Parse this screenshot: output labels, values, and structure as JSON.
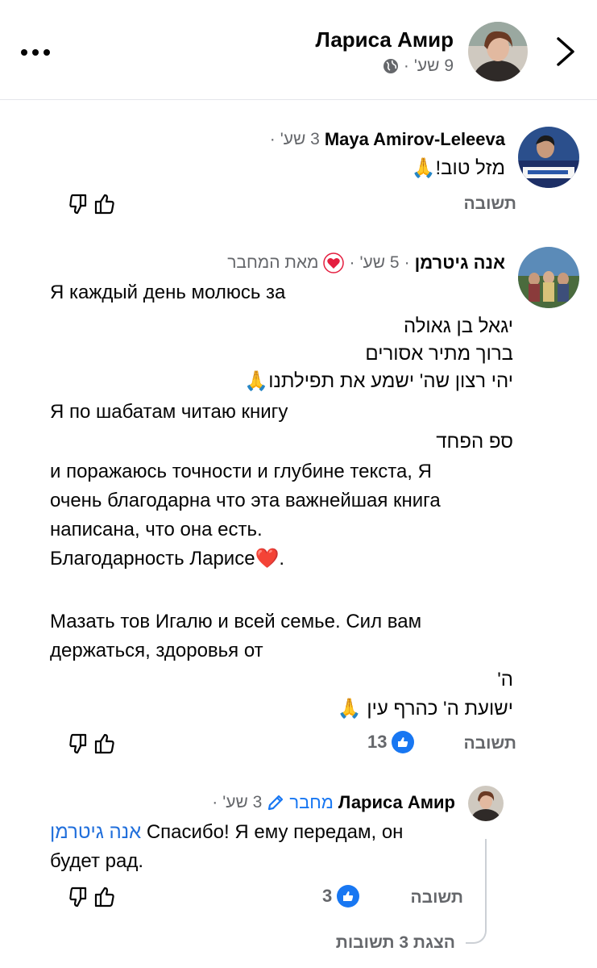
{
  "header": {
    "author_name": "Лариса Амир",
    "time": "9 שע'",
    "dot": "·"
  },
  "comments": [
    {
      "name": "Maya Amirov-Leleeva",
      "time": "3 שע'",
      "dot": "·",
      "lines": [
        "מזל טוב!🙏"
      ],
      "reply_label": "תשובה"
    },
    {
      "name": "אנה  גיטרמן",
      "time": "5 שע'",
      "dot1": "·",
      "dot2": "·",
      "badge": "מאת המחבר",
      "lines": [
        "Я каждый день молюсь за",
        "יגאל בן גאולה",
        "ברוך מתיר אסורים",
        "יהי רצון שה' ישמע את תפילתנו🙏",
        "Я по шабатам читаю книгу",
        "ספ הפחד",
        "и поражаюсь точности и глубине текста, Я",
        "очень благодарна что эта важнейшая книга",
        "написана, что она есть.",
        "Благодарность Ларисе❤️.",
        "Мазать тов Игалю и всей семье. Сил вам",
        "держаться, здоровья от",
        "ה'",
        "ישועת ה' כהרף עין 🙏"
      ],
      "reply_label": "תשובה",
      "likes": "13"
    },
    {
      "name": "Лариса Амир",
      "author_label": "מחבר",
      "time": "3 שע'",
      "dot": "·",
      "mention": "אנה גיטרמן",
      "text_line1": " Спасибо! Я ему передам, он",
      "text_line2": "будет рад.",
      "reply_label": "תשובה",
      "likes": "3",
      "view_replies": "הצגת 3 תשובות"
    }
  ],
  "icons": {
    "more": "more-icon",
    "back": "chevron-right-icon",
    "globe": "globe-icon",
    "upvote": "thumbs-up-outline-icon",
    "downvote": "thumbs-down-outline-icon",
    "like": "like-icon",
    "heart": "heart-icon",
    "pencil": "pencil-icon"
  },
  "colors": {
    "accent": "#1877f2",
    "mention": "#216fdb",
    "secondary_text": "#65676b",
    "heart_badge": "#e41e3f"
  }
}
